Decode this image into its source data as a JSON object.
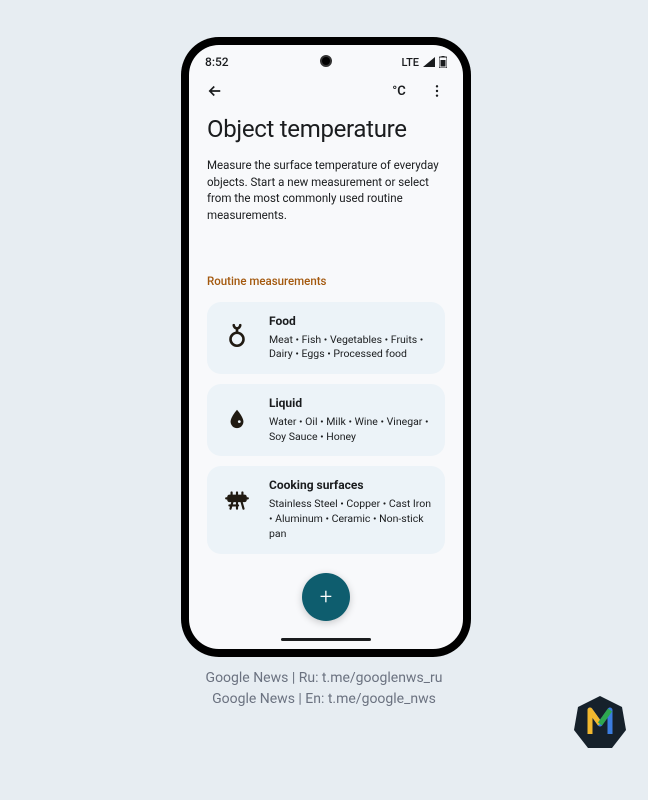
{
  "status": {
    "time": "8:52",
    "network": "LTE"
  },
  "appbar": {
    "unit": "°C"
  },
  "page": {
    "title": "Object temperature",
    "description": "Measure the surface temperature of everyday objects. Start a new measurement or select from the most commonly used routine measurements."
  },
  "section_label": "Routine measurements",
  "cards": [
    {
      "title": "Food",
      "subtitle": "Meat • Fish • Vegetables • Fruits • Dairy • Eggs • Processed food"
    },
    {
      "title": "Liquid",
      "subtitle": "Water • Oil • Milk • Wine • Vinegar • Soy Sauce • Honey"
    },
    {
      "title": "Cooking surfaces",
      "subtitle": "Stainless Steel • Copper • Cast Iron • Aluminum • Ceramic • Non-stick pan"
    }
  ],
  "fab_label": "+",
  "caption": {
    "line1": "Google News | Ru: t.me/googlenws_ru",
    "line2": "Google News | En: t.me/google_nws"
  }
}
